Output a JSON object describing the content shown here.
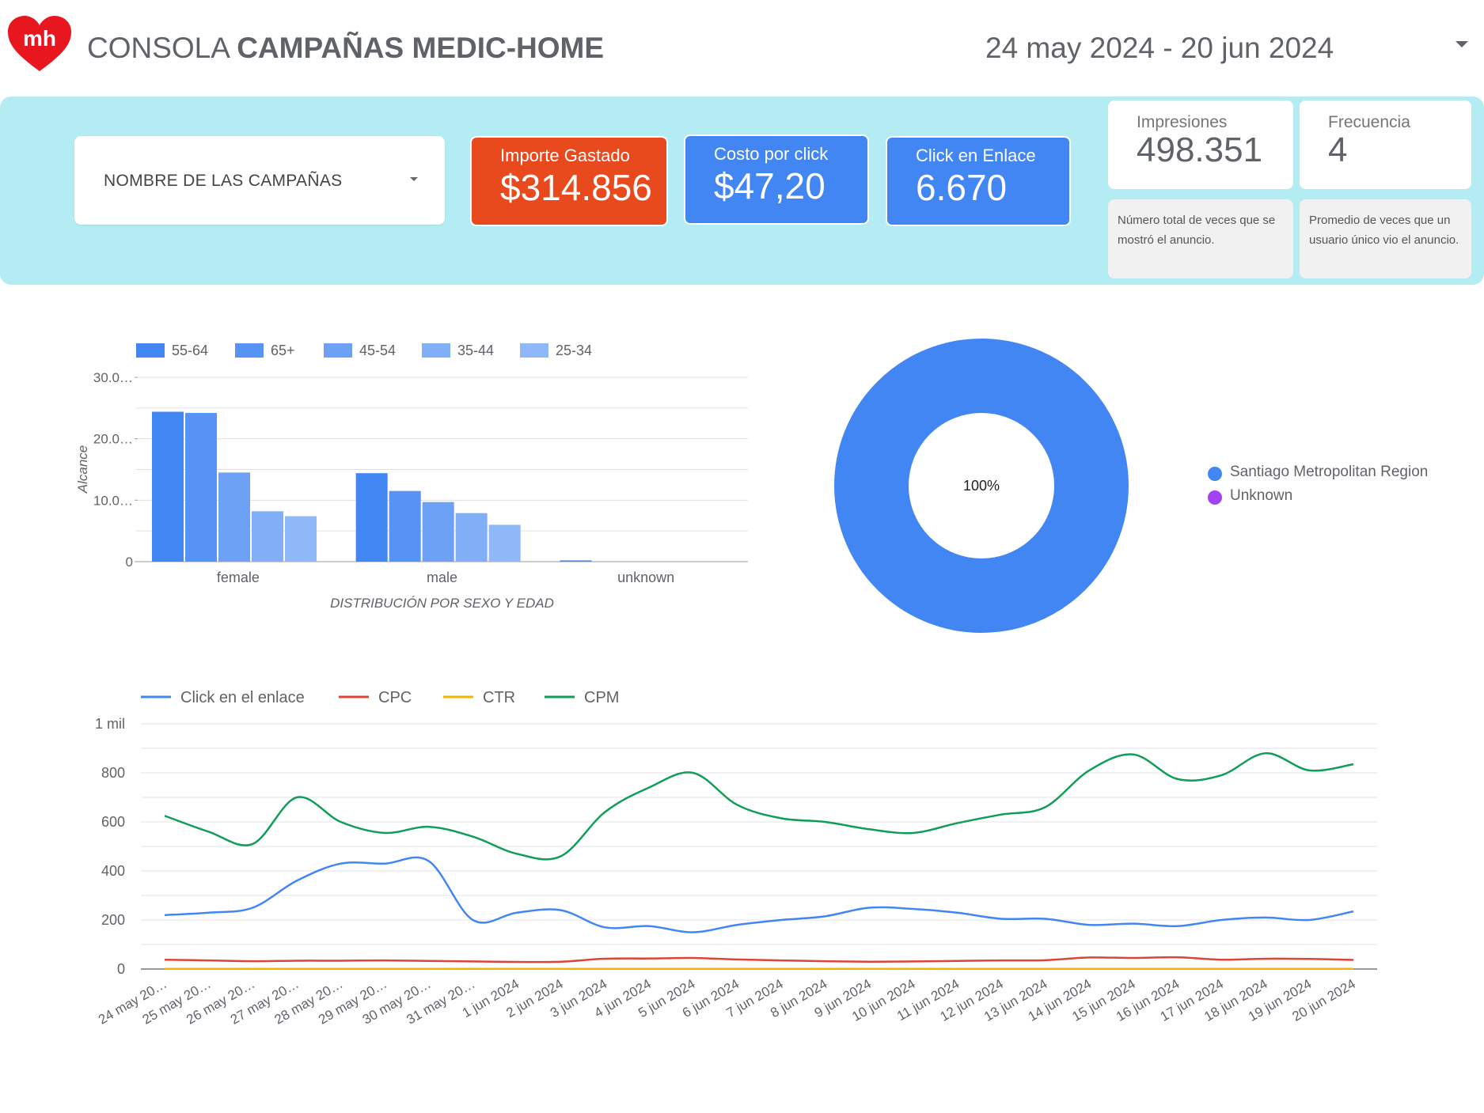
{
  "header": {
    "logo_text": "mh",
    "title_prefix": "CONSOLA ",
    "title_bold": "CAMPAÑAS MEDIC-HOME",
    "date_range": "24 may 2024 - 20 jun 2024"
  },
  "filters": {
    "campaign_label": "NOMBRE DE LAS CAMPAÑAS"
  },
  "kpis": {
    "importe": {
      "label": "Importe Gastado",
      "value": "$314.856",
      "color": "#e8491d"
    },
    "cpc": {
      "label": "Costo por click",
      "value": "$47,20",
      "color": "#4286f4"
    },
    "click": {
      "label": "Click en Enlace",
      "value": "6.670",
      "color": "#4286f4"
    }
  },
  "stats": {
    "impresiones": {
      "label": "Impresiones",
      "value": "498.351",
      "note": "Número total de veces que se mostró el anuncio."
    },
    "frecuencia": {
      "label": "Frecuencia",
      "value": "4",
      "note": "Promedio de veces que un usuario único vio el anuncio."
    }
  },
  "chart_data": [
    {
      "type": "bar",
      "categories": [
        "female",
        "male",
        "unknown"
      ],
      "series": [
        {
          "name": "55-64",
          "values": [
            24400,
            14400,
            200
          ],
          "color": "#4286f4"
        },
        {
          "name": "65+",
          "values": [
            24200,
            11500,
            0
          ],
          "color": "#5693f5"
        },
        {
          "name": "45-54",
          "values": [
            14500,
            9700,
            0
          ],
          "color": "#6ca1f6"
        },
        {
          "name": "35-44",
          "values": [
            8200,
            7900,
            0
          ],
          "color": "#81aff7"
        },
        {
          "name": "25-34",
          "values": [
            7400,
            6000,
            0
          ],
          "color": "#8fb8f8"
        }
      ],
      "xlabel": "DISTRIBUCIÓN POR SEXO Y EDAD",
      "ylabel": "Alcance",
      "yticks": [
        "0",
        "10.0…",
        "20.0…",
        "30.0…"
      ],
      "ylim": [
        0,
        30000
      ],
      "grid": true,
      "legend": "top"
    },
    {
      "type": "pie",
      "labels": [
        "Santiago Metropolitan Region",
        "Unknown"
      ],
      "values": [
        100,
        0
      ],
      "colors": [
        "#4286f4",
        "#a142f4"
      ],
      "center_label": "100%",
      "legend": "right"
    },
    {
      "type": "line",
      "x": [
        "24 may 20…",
        "25 may 20…",
        "26 may 20…",
        "27 may 20…",
        "28 may 20…",
        "29 may 20…",
        "30 may 20…",
        "31 may 20…",
        "1 jun 2024",
        "2 jun 2024",
        "3 jun 2024",
        "4 jun 2024",
        "5 jun 2024",
        "6 jun 2024",
        "7 jun 2024",
        "8 jun 2024",
        "9 jun 2024",
        "10 jun 2024",
        "11 jun 2024",
        "12 jun 2024",
        "13 jun 2024",
        "14 jun 2024",
        "15 jun 2024",
        "16 jun 2024",
        "17 jun 2024",
        "18 jun 2024",
        "19 jun 2024",
        "20 jun 2024"
      ],
      "series": [
        {
          "name": "Click en el enlace",
          "color": "#4286f4",
          "values": [
            220,
            230,
            250,
            360,
            430,
            430,
            440,
            200,
            230,
            240,
            170,
            175,
            150,
            180,
            200,
            215,
            250,
            245,
            230,
            205,
            205,
            180,
            185,
            175,
            200,
            210,
            200,
            235
          ]
        },
        {
          "name": "CPC",
          "color": "#db4437",
          "values": [
            38,
            35,
            32,
            34,
            34,
            35,
            33,
            31,
            29,
            30,
            42,
            43,
            45,
            39,
            35,
            32,
            30,
            31,
            33,
            35,
            36,
            47,
            45,
            48,
            38,
            42,
            41,
            37
          ]
        },
        {
          "name": "CTR",
          "color": "#f4b400",
          "values": [
            1,
            1,
            1,
            1,
            1,
            1,
            1,
            1,
            1,
            1,
            1,
            1,
            1,
            1,
            1,
            1,
            1,
            1,
            1,
            1,
            1,
            1,
            1,
            1,
            1,
            1,
            1,
            1
          ]
        },
        {
          "name": "CPM",
          "color": "#0f9d58",
          "values": [
            625,
            560,
            510,
            700,
            600,
            555,
            580,
            540,
            470,
            460,
            640,
            740,
            800,
            670,
            615,
            600,
            570,
            555,
            595,
            630,
            660,
            810,
            875,
            775,
            790,
            880,
            810,
            835
          ]
        }
      ],
      "yticks": [
        "0",
        "200",
        "400",
        "600",
        "800",
        "1 mil"
      ],
      "ylim": [
        0,
        1000
      ],
      "grid": true,
      "legend": "top"
    }
  ]
}
